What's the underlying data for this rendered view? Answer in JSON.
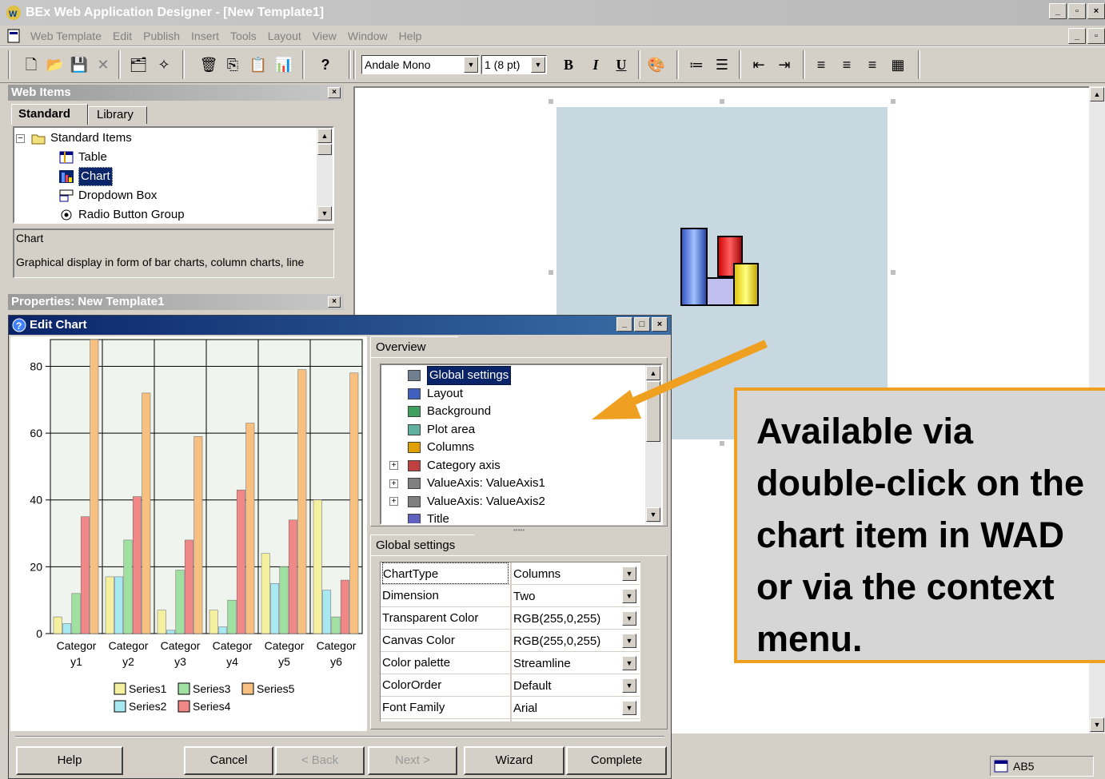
{
  "window": {
    "title": "BEx Web Application Designer - [New Template1]"
  },
  "menu": [
    "Web Template",
    "Edit",
    "Publish",
    "Insert",
    "Tools",
    "Layout",
    "View",
    "Window",
    "Help"
  ],
  "toolbar": {
    "font_name": "Andale Mono",
    "font_size": "1 (8 pt)",
    "bold": "B",
    "italic": "I",
    "underline": "U",
    "help": "?"
  },
  "web_items": {
    "header": "Web Items",
    "tabs": [
      "Standard",
      "Library"
    ],
    "tree_root": "Standard Items",
    "items": [
      "Table",
      "Chart",
      "Dropdown Box",
      "Radio Button Group"
    ],
    "selected": "Chart",
    "desc_title": "Chart",
    "desc_text": "Graphical display in form of bar charts, column charts, line"
  },
  "properties": {
    "header": "Properties: New Template1"
  },
  "edit_chart": {
    "title": "Edit Chart",
    "overview_tab": "Overview",
    "overview_items": [
      "Global settings",
      "Layout",
      "Background",
      "Plot area",
      "Columns",
      "Category axis",
      "ValueAxis: ValueAxis1",
      "ValueAxis: ValueAxis2",
      "Title"
    ],
    "global_tab": "Global settings",
    "settings": [
      {
        "name": "ChartType",
        "value": "Columns"
      },
      {
        "name": "Dimension",
        "value": "Two"
      },
      {
        "name": "Transparent Color",
        "value": "RGB(255,0,255)"
      },
      {
        "name": "Canvas Color",
        "value": "RGB(255,0,255)"
      },
      {
        "name": "Color palette",
        "value": "Streamline"
      },
      {
        "name": "ColorOrder",
        "value": "Default"
      },
      {
        "name": "Font Family",
        "value": "Arial"
      }
    ],
    "buttons": {
      "help": "Help",
      "cancel": "Cancel",
      "back": "< Back",
      "next": "Next >",
      "wizard": "Wizard",
      "complete": "Complete"
    }
  },
  "statusbar": {
    "cell": "AB5"
  },
  "callout": {
    "text": "Available via double-click on the chart item in WAD or via the context menu."
  },
  "colors": {
    "series1": "#f5f0a0",
    "series2": "#a8e8f0",
    "series3": "#a0e0a0",
    "series4": "#f08888",
    "series5": "#f8c080",
    "canvas": "#c8d8e0",
    "callout_border": "#f0a020"
  },
  "chart_data": {
    "type": "bar",
    "categories": [
      "Categor\ny1",
      "Categor\ny2",
      "Categor\ny3",
      "Categor\ny4",
      "Categor\ny5",
      "Categor\ny6"
    ],
    "series": [
      {
        "name": "Series1",
        "values": [
          5,
          17,
          7,
          7,
          24,
          40
        ]
      },
      {
        "name": "Series2",
        "values": [
          3,
          17,
          1,
          2,
          15,
          13
        ]
      },
      {
        "name": "Series3",
        "values": [
          12,
          28,
          19,
          10,
          20,
          5
        ]
      },
      {
        "name": "Series4",
        "values": [
          35,
          41,
          28,
          43,
          34,
          16
        ]
      },
      {
        "name": "Series5",
        "values": [
          88,
          72,
          59,
          63,
          79,
          78
        ]
      }
    ],
    "yticks": [
      0,
      20,
      40,
      60,
      80
    ],
    "ylim": [
      0,
      88
    ],
    "grid": true,
    "legend": "bottom"
  }
}
